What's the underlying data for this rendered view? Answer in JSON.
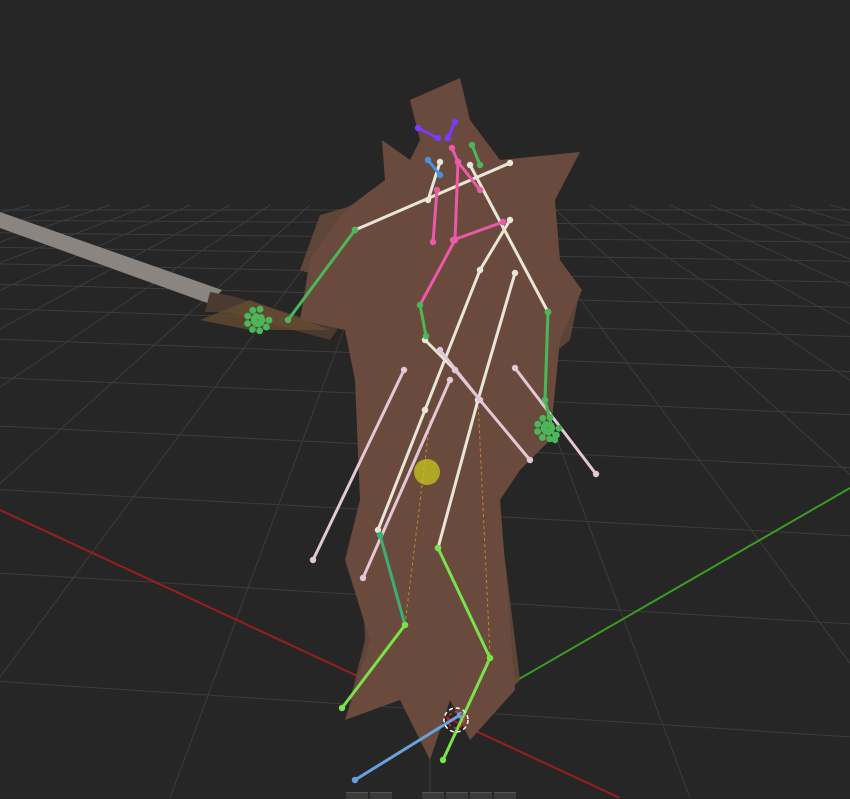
{
  "viewport": {
    "background": "#262626",
    "grid_color": "#3c3c3c",
    "x_axis_color": "#9a1e1e",
    "y_axis_color": "#3a9a24",
    "model_color": "#6a4a3c",
    "sword_color": "#8a8580"
  },
  "bone_colors": {
    "default": "#e8e6d8",
    "deform": "#e2c8d6",
    "spine": "#ea5aa8",
    "face": "#7a3aff",
    "eye": "#4a90e0",
    "limb": "#4ab85a",
    "leg": "#7ae24a",
    "ik": "#6aa0e0",
    "pole_line": "#c08a2a",
    "cursor": "#c8c81e"
  },
  "toolbar": {
    "tabs": [
      {
        "name": "tab-1"
      },
      {
        "name": "tab-2"
      },
      {
        "name": "tab-3"
      },
      {
        "name": "tab-4"
      },
      {
        "name": "tab-5"
      },
      {
        "name": "tab-6"
      }
    ]
  }
}
